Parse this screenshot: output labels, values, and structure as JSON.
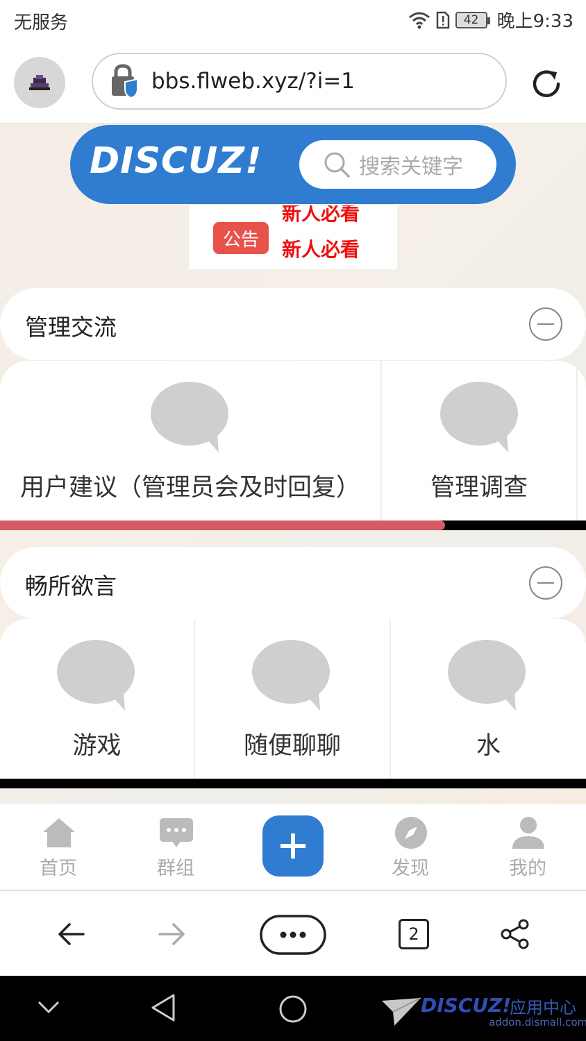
{
  "status_bar": {
    "carrier": "无服务",
    "battery": "42",
    "time": "晚上9:33"
  },
  "browser": {
    "url": "bbs.flweb.xyz/?i=1"
  },
  "header": {
    "logo": "DISCUZ!",
    "search_placeholder": "搜索关键字"
  },
  "notice": {
    "badge": "公告",
    "ghost_text": "新人必看",
    "text": "新人必看"
  },
  "sections": [
    {
      "title": "管理交流",
      "forums": [
        {
          "label": "用户建议（管理员会及时回复）"
        },
        {
          "label": "管理调查"
        }
      ],
      "scroll_progress": 0.76
    },
    {
      "title": "畅所欲言",
      "forums": [
        {
          "label": "游戏"
        },
        {
          "label": "随便聊聊"
        },
        {
          "label": "水"
        }
      ]
    }
  ],
  "tabbar": {
    "items": [
      {
        "label": "首页",
        "icon": "home-icon"
      },
      {
        "label": "群组",
        "icon": "chat-group-icon"
      },
      {
        "label": "",
        "icon": "plus-icon"
      },
      {
        "label": "发现",
        "icon": "compass-icon"
      },
      {
        "label": "我的",
        "icon": "user-icon"
      }
    ]
  },
  "browser_nav": {
    "tab_count": "2"
  },
  "watermark": {
    "brand": "DISCUZ!",
    "caption": "应用中心",
    "site": "addon.dismall.com"
  },
  "colors": {
    "brand_blue": "#2f7cd0",
    "notice_red": "#e9514b",
    "progress_red": "#d65a63"
  }
}
